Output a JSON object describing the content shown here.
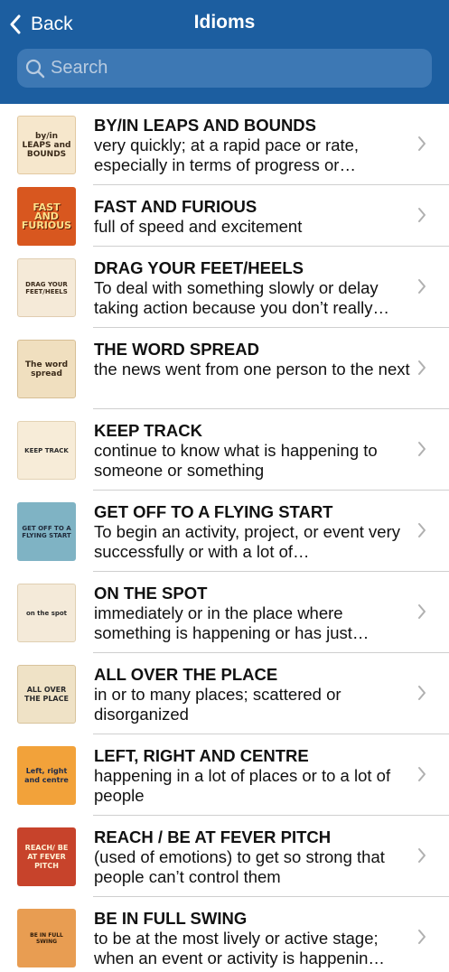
{
  "header": {
    "back_label": "Back",
    "title": "Idioms",
    "background_color": "#1c5ea0"
  },
  "search": {
    "placeholder": "Search",
    "value": ""
  },
  "items": [
    {
      "idiom": "BY/IN LEAPS AND BOUNDS",
      "meaning": "very quickly; at a rapid pace or rate, especially in terms of progress or…",
      "thumb_text": "by/in LEAPS and BOUNDS"
    },
    {
      "idiom": "FAST AND FURIOUS",
      "meaning": "full of speed and excitement",
      "thumb_text": "FAST AND FURIOUS"
    },
    {
      "idiom": "DRAG YOUR FEET/HEELS",
      "meaning": "To deal with something slowly or delay taking action because you don’t really…",
      "thumb_text": "DRAG YOUR FEET/HEELS"
    },
    {
      "idiom": "THE WORD SPREAD",
      "meaning": "the news went from one person to the next",
      "thumb_text": "The word spread"
    },
    {
      "idiom": "KEEP TRACK",
      "meaning": "continue to know what is happening to someone or something",
      "thumb_text": "KEEP TRACK"
    },
    {
      "idiom": "GET OFF TO A FLYING START",
      "meaning": "To begin an activity, project, or event very successfully or with a lot of…",
      "thumb_text": "GET OFF TO A FLYING START"
    },
    {
      "idiom": "ON THE SPOT",
      "meaning": "immediately or in the place where something is happening or has just…",
      "thumb_text": "on the spot"
    },
    {
      "idiom": "ALL OVER THE PLACE",
      "meaning": "in or to many places; scattered or disorganized",
      "thumb_text": "ALL OVER THE PLACE"
    },
    {
      "idiom": "LEFT, RIGHT AND CENTRE",
      "meaning": "happening in a lot of places or to a lot of people",
      "thumb_text": "Left, right and centre"
    },
    {
      "idiom": "REACH / BE AT FEVER PITCH",
      "meaning": "(used of emotions) to get so strong that people can’t control them",
      "thumb_text": "REACH/ BE AT FEVER PITCH"
    },
    {
      "idiom": "BE IN FULL SWING",
      "meaning": "to be at the most lively or active stage; when an event or activity is happenin…",
      "thumb_text": "BE IN FULL SWING"
    }
  ],
  "icons": {
    "back": "chevron-left-icon",
    "search": "magnifier-icon",
    "row": "chevron-right-icon"
  }
}
